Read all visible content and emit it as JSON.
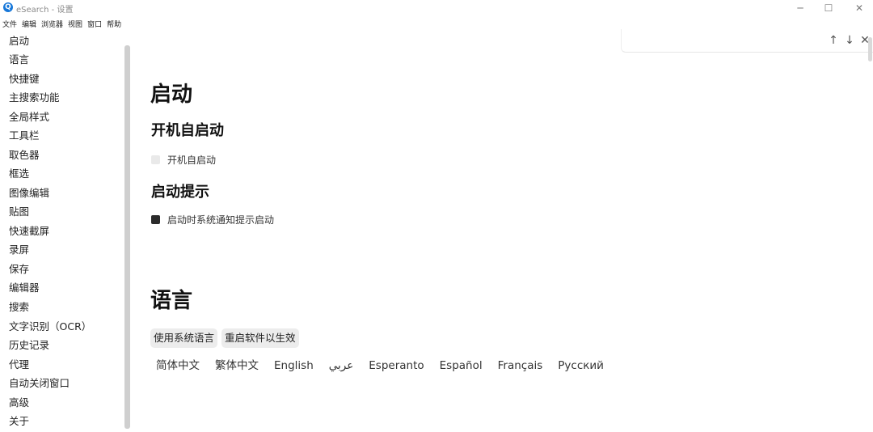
{
  "window": {
    "icon_letter": "Q",
    "title": "eSearch - 设置",
    "minimize_glyph": "─",
    "maximize_glyph": "☐",
    "close_glyph": "✕"
  },
  "menubar": [
    "文件",
    "编辑",
    "浏览器",
    "视图",
    "窗口",
    "帮助"
  ],
  "sidebar": {
    "items": [
      "启动",
      "语言",
      "快捷键",
      "主搜索功能",
      "全局样式",
      "工具栏",
      "取色器",
      "框选",
      "图像编辑",
      "贴图",
      "快速截屏",
      "录屏",
      "保存",
      "编辑器",
      "搜索",
      "文字识别（OCR）",
      "历史记录",
      "代理",
      "自动关闭窗口",
      "高级",
      "关于"
    ]
  },
  "findbar": {
    "up_glyph": "↑",
    "down_glyph": "↓",
    "close_glyph": "✕"
  },
  "startup": {
    "heading": "启动",
    "autostart": {
      "heading": "开机自启动",
      "checkbox_label": "开机自启动",
      "checked": false
    },
    "notify": {
      "heading": "启动提示",
      "checkbox_label": "启动时系统通知提示启动",
      "checked": true
    }
  },
  "language": {
    "heading": "语言",
    "use_system_button": "使用系统语言",
    "restart_button": "重启软件以生效",
    "options": [
      "简体中文",
      "繁体中文",
      "English",
      "عربي",
      "Esperanto",
      "Español",
      "Français",
      "Русский"
    ]
  }
}
